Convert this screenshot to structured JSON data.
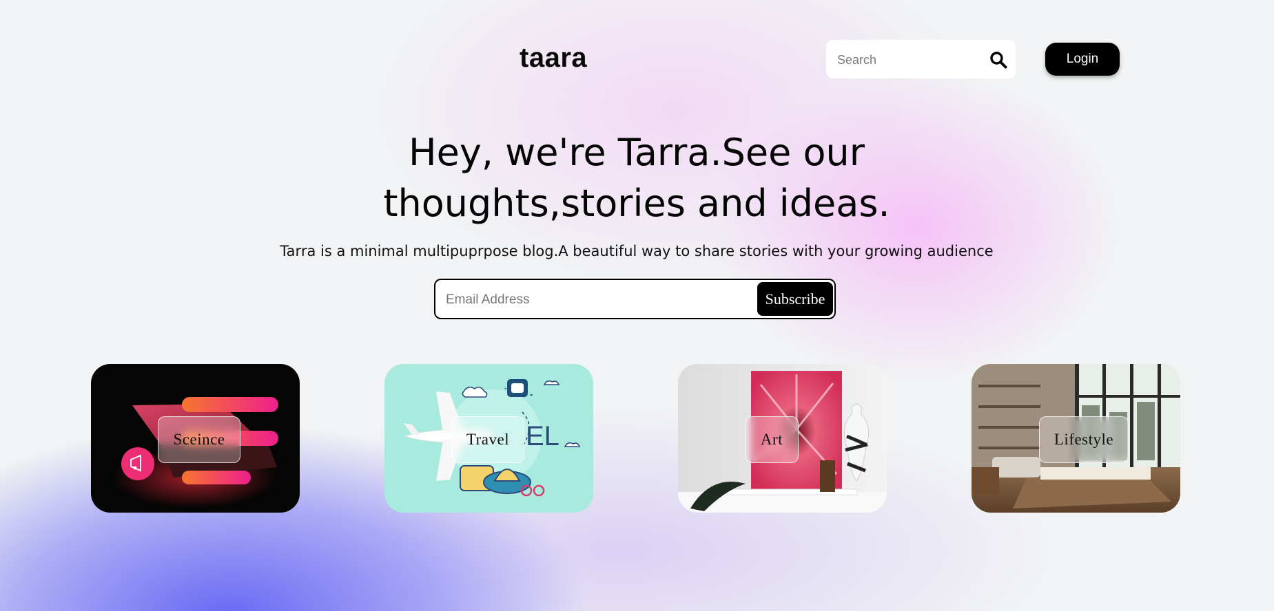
{
  "header": {
    "logo": "taara",
    "search_placeholder": "Search",
    "login_label": "Login"
  },
  "hero": {
    "title_line1": "Hey, we're Tarra.See our",
    "title_line2": "thoughts,stories and ideas.",
    "subtitle": "Tarra is a minimal multipuprpose blog.A beautiful way to share stories with your growing audience"
  },
  "subscribe": {
    "email_placeholder": "Email Address",
    "button_label": "Subscribe"
  },
  "categories": [
    {
      "label": "Sceince",
      "image": "laptop-megaphone-image"
    },
    {
      "label": "Travel",
      "image": "airplane-travel-image"
    },
    {
      "label": "Art",
      "image": "painting-vase-image"
    },
    {
      "label": "Lifestyle",
      "image": "living-room-image"
    }
  ],
  "colors": {
    "button_bg": "#000000",
    "pink_glow": "#f6baf8",
    "blue_glow": "#6668f4",
    "background": "#f1f3f4"
  }
}
